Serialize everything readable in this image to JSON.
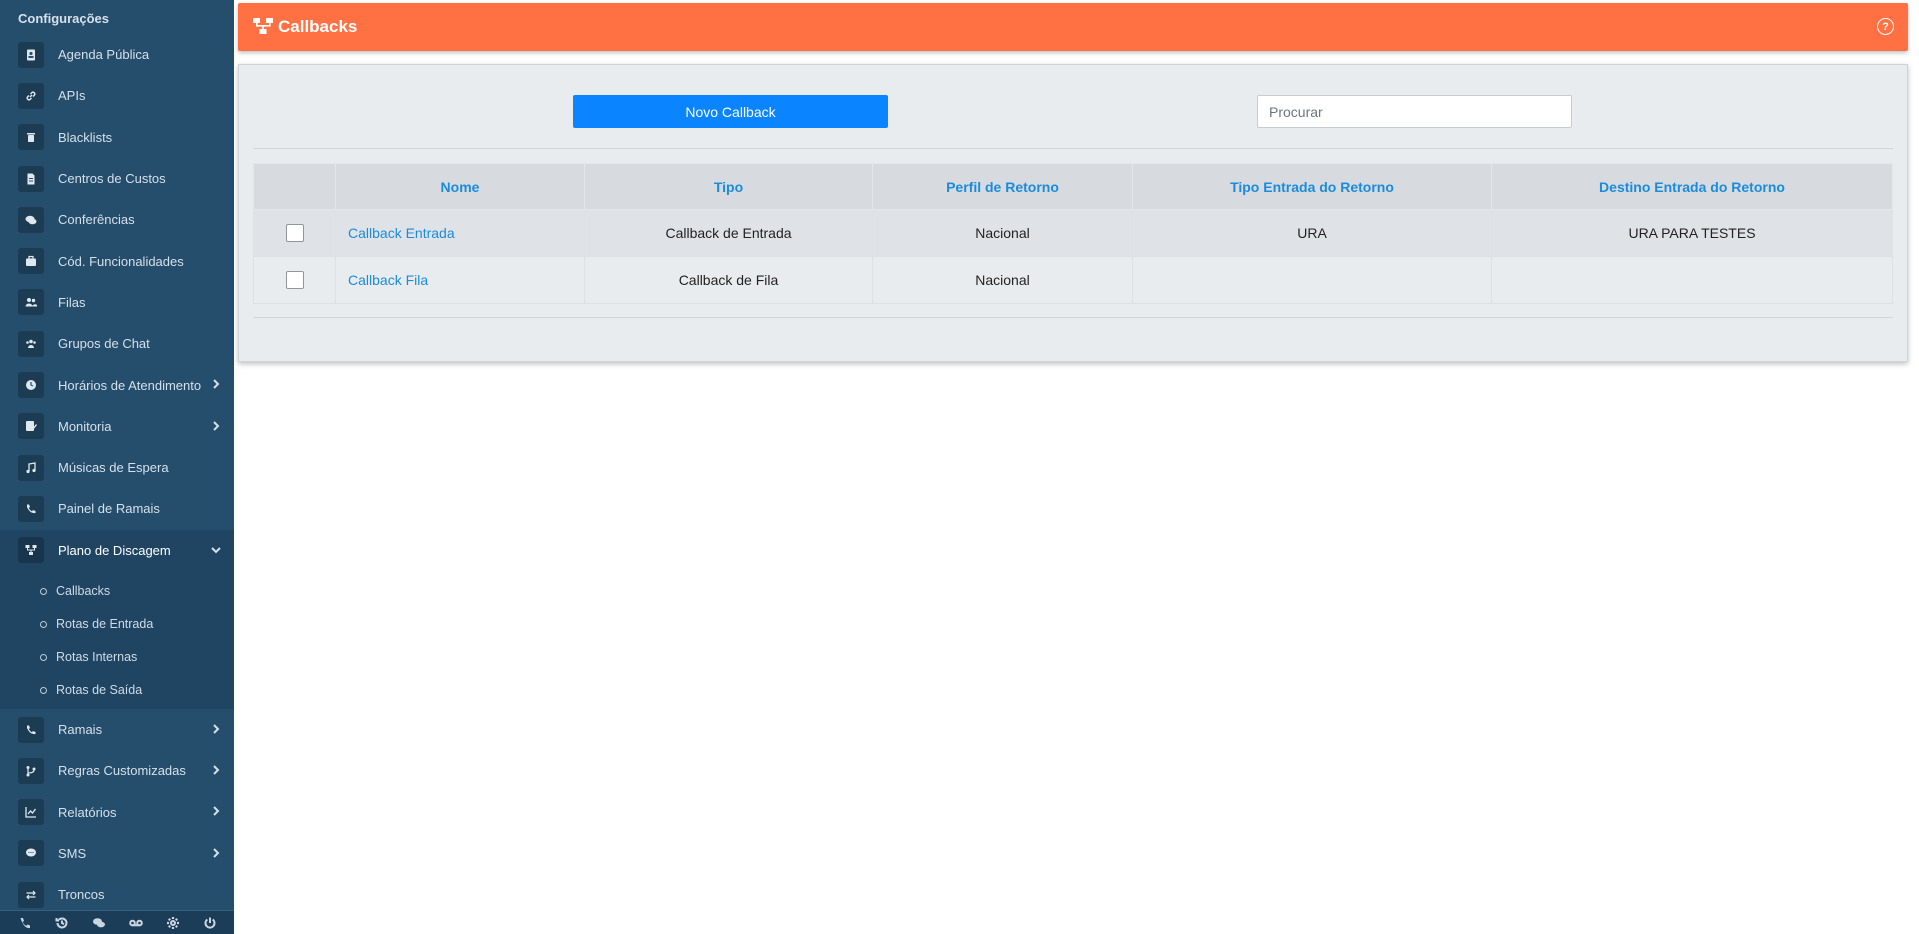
{
  "sidebar": {
    "section_title": "Configurações",
    "items": [
      {
        "label": "Agenda Pública",
        "icon": "address-book-icon"
      },
      {
        "label": "APIs",
        "icon": "link-icon"
      },
      {
        "label": "Blacklists",
        "icon": "trash-icon"
      },
      {
        "label": "Centros de Custos",
        "icon": "document-icon"
      },
      {
        "label": "Conferências",
        "icon": "chat-icon"
      },
      {
        "label": "Cód. Funcionalidades",
        "icon": "briefcase-icon"
      },
      {
        "label": "Filas",
        "icon": "users-icon"
      },
      {
        "label": "Grupos de Chat",
        "icon": "group-icon"
      },
      {
        "label": "Horários de Atendimento",
        "icon": "clock-icon"
      },
      {
        "label": "Monitoria",
        "icon": "checklist-icon"
      },
      {
        "label": "Músicas de Espera",
        "icon": "music-icon"
      },
      {
        "label": "Painel de Ramais",
        "icon": "phone-icon"
      },
      {
        "label": "Plano de Discagem",
        "icon": "sitemap-icon"
      },
      {
        "label": "Ramais",
        "icon": "phone-icon"
      },
      {
        "label": "Regras Customizadas",
        "icon": "branch-icon"
      },
      {
        "label": "Relatórios",
        "icon": "chart-icon"
      },
      {
        "label": "SMS",
        "icon": "sms-icon"
      },
      {
        "label": "Troncos",
        "icon": "exchange-icon"
      }
    ],
    "submenu": [
      "Callbacks",
      "Rotas de Entrada",
      "Rotas Internas",
      "Rotas de Saída"
    ],
    "bottom_icons": [
      "phone-icon",
      "history-icon",
      "chat-icon",
      "voicemail-icon",
      "gear-icon",
      "power-icon"
    ]
  },
  "header": {
    "title": "Callbacks",
    "help": "?",
    "accent": "#ff7043"
  },
  "toolbar": {
    "new_label": "Novo Callback",
    "search_placeholder": "Procurar",
    "button_color": "#0a84ff"
  },
  "table": {
    "columns": [
      "Nome",
      "Tipo",
      "Perfil de Retorno",
      "Tipo Entrada do Retorno",
      "Destino Entrada do Retorno"
    ],
    "rows": [
      {
        "nome": "Callback Entrada",
        "tipo": "Callback de Entrada",
        "perfil": "Nacional",
        "tipo_entrada": "URA",
        "destino": "URA PARA TESTES"
      },
      {
        "nome": "Callback Fila",
        "tipo": "Callback de Fila",
        "perfil": "Nacional",
        "tipo_entrada": "",
        "destino": ""
      }
    ]
  }
}
